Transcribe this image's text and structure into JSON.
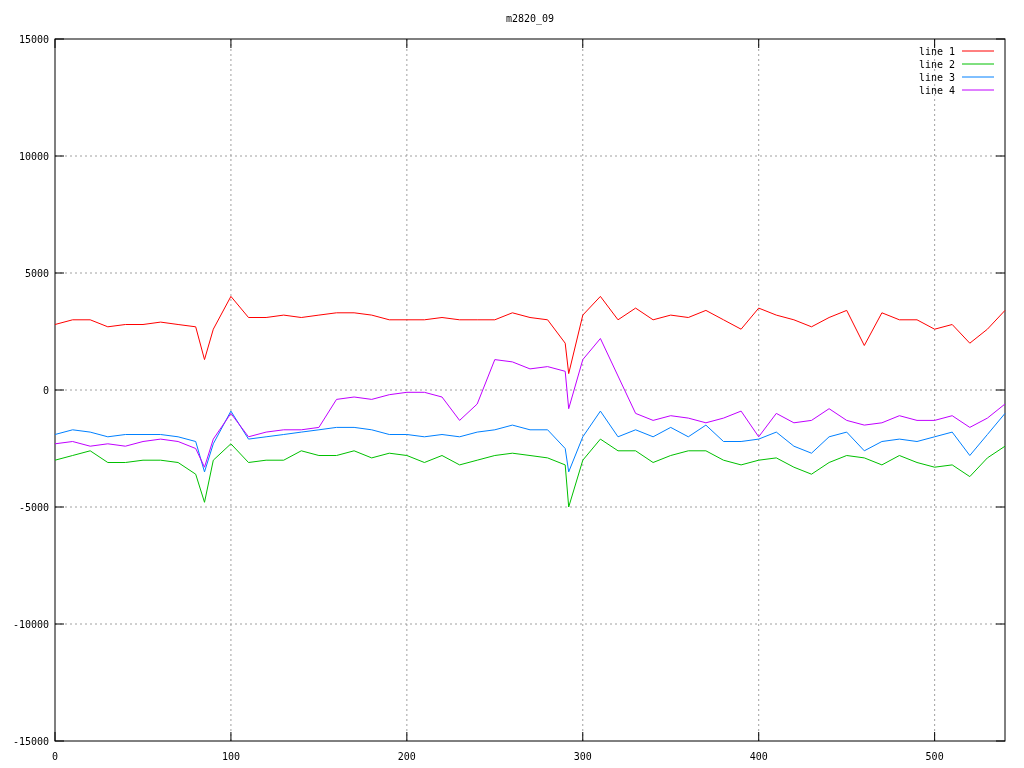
{
  "chart": {
    "chart_data": {
      "type": "line",
      "title": "m2820_09",
      "x": [
        0,
        10,
        20,
        30,
        40,
        50,
        60,
        70,
        80,
        85,
        90,
        100,
        110,
        120,
        130,
        140,
        150,
        160,
        170,
        180,
        190,
        200,
        210,
        220,
        230,
        240,
        250,
        260,
        270,
        280,
        290,
        292,
        300,
        310,
        320,
        330,
        340,
        350,
        360,
        370,
        380,
        390,
        400,
        410,
        420,
        430,
        440,
        450,
        460,
        470,
        480,
        490,
        500,
        510,
        520,
        530,
        540
      ],
      "series": [
        {
          "name": "line 1",
          "color": "#ff0000",
          "values": [
            2800,
            3000,
            3000,
            2700,
            2800,
            2800,
            2900,
            2800,
            2700,
            1300,
            2600,
            4000,
            3100,
            3100,
            3200,
            3100,
            3200,
            3300,
            3300,
            3200,
            3000,
            3000,
            3000,
            3100,
            3000,
            3000,
            3000,
            3300,
            3100,
            3000,
            2000,
            700,
            3200,
            4000,
            3000,
            3500,
            3000,
            3200,
            3100,
            3400,
            3000,
            2600,
            3500,
            3200,
            3000,
            2700,
            3100,
            3400,
            1900,
            3300,
            3000,
            3000,
            2600,
            2800,
            2000,
            2600,
            3400
          ]
        },
        {
          "name": "line 2",
          "color": "#00c000",
          "values": [
            -3000,
            -2800,
            -2600,
            -3100,
            -3100,
            -3000,
            -3000,
            -3100,
            -3600,
            -4800,
            -3000,
            -2300,
            -3100,
            -3000,
            -3000,
            -2600,
            -2800,
            -2800,
            -2600,
            -2900,
            -2700,
            -2800,
            -3100,
            -2800,
            -3200,
            -3000,
            -2800,
            -2700,
            -2800,
            -2900,
            -3200,
            -5000,
            -3000,
            -2100,
            -2600,
            -2600,
            -3100,
            -2800,
            -2600,
            -2600,
            -3000,
            -3200,
            -3000,
            -2900,
            -3300,
            -3600,
            -3100,
            -2800,
            -2900,
            -3200,
            -2800,
            -3100,
            -3300,
            -3200,
            -3700,
            -2900,
            -2400
          ]
        },
        {
          "name": "line 3",
          "color": "#0080ff",
          "values": [
            -1900,
            -1700,
            -1800,
            -2000,
            -1900,
            -1900,
            -1900,
            -2000,
            -2200,
            -3500,
            -2300,
            -900,
            -2100,
            -2000,
            -1900,
            -1800,
            -1700,
            -1600,
            -1600,
            -1700,
            -1900,
            -1900,
            -2000,
            -1900,
            -2000,
            -1800,
            -1700,
            -1500,
            -1700,
            -1700,
            -2500,
            -3500,
            -2000,
            -900,
            -2000,
            -1700,
            -2000,
            -1600,
            -2000,
            -1500,
            -2200,
            -2200,
            -2100,
            -1800,
            -2400,
            -2700,
            -2000,
            -1800,
            -2600,
            -2200,
            -2100,
            -2200,
            -2000,
            -1800,
            -2800,
            -1900,
            -1000
          ]
        },
        {
          "name": "line 4",
          "color": "#c000ff",
          "values": [
            -2300,
            -2200,
            -2400,
            -2300,
            -2400,
            -2200,
            -2100,
            -2200,
            -2500,
            -3300,
            -2100,
            -1000,
            -2000,
            -1800,
            -1700,
            -1700,
            -1600,
            -400,
            -300,
            -400,
            -200,
            -100,
            -100,
            -300,
            -1300,
            -600,
            1300,
            1200,
            900,
            1000,
            800,
            -800,
            1300,
            2200,
            600,
            -1000,
            -1300,
            -1100,
            -1200,
            -1400,
            -1200,
            -900,
            -2000,
            -1000,
            -1400,
            -1300,
            -800,
            -1300,
            -1500,
            -1400,
            -1100,
            -1300,
            -1300,
            -1100,
            -1600,
            -1200,
            -600
          ]
        }
      ],
      "grid": true,
      "legend": true,
      "xlim": [
        0,
        540
      ],
      "ylim": [
        -15000,
        15000
      ],
      "xticks": [
        0,
        100,
        200,
        300,
        400,
        500
      ],
      "yticks": [
        -15000,
        -10000,
        -5000,
        0,
        5000,
        10000,
        15000
      ]
    }
  }
}
